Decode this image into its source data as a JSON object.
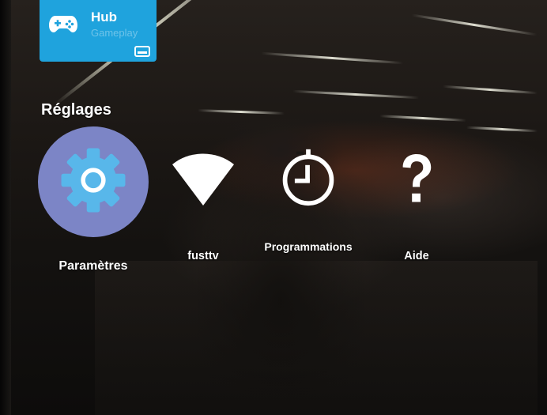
{
  "hub": {
    "title": "Hub",
    "subtitle": "Gameplay",
    "icon": "gamepad-icon",
    "badge_icon": "input-source-icon"
  },
  "section": {
    "title": "Réglages"
  },
  "items": [
    {
      "label": "Paramètres",
      "icon": "gear-icon",
      "selected": true
    },
    {
      "label": "fusttv",
      "icon": "wifi-icon",
      "selected": false
    },
    {
      "label": "Programmations",
      "icon": "timer-icon",
      "selected": false
    },
    {
      "label": "Aide",
      "icon": "question-mark-icon",
      "selected": false
    }
  ],
  "colors": {
    "hub_tile": "#1fa3dd",
    "selected_circle": "#7c85c6",
    "gear_fill": "#58b7ea",
    "text": "#ffffff"
  }
}
